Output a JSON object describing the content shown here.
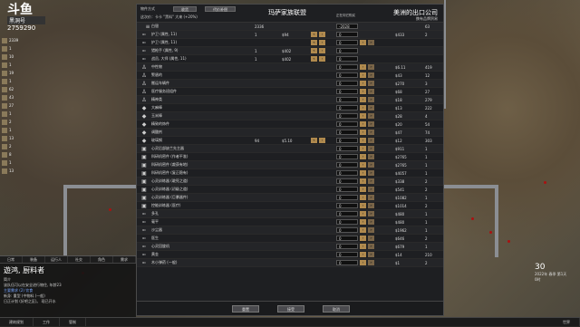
{
  "hud": {
    "logo_main": "斗鱼",
    "logo_sub": "黑洞号",
    "logo_num": "2759290",
    "resources": [
      "2339",
      "1",
      "10",
      "1",
      "19",
      "1",
      "62",
      "43",
      "27",
      "1",
      "2",
      "1",
      "13",
      "2",
      "8",
      "1",
      "13"
    ]
  },
  "dialog": {
    "mode_label": "物件方式",
    "tab_a": "收货",
    "tab_b": "代价补偿",
    "hint": "这次价：卡卡  \"黑料\" 大来 (+20%)",
    "left_title": "玛萨家族联盟",
    "right_title": "美洲的出口公司",
    "right_sub": "携有品牌贸易",
    "mid_sub": "正在向它购买",
    "silver": {
      "name": "白银",
      "left": "2336",
      "qty": "-2028",
      "right": "63"
    },
    "rows": [
      {
        "icon": "gun-icon",
        "name": "护卫 (属性, 11)",
        "lc": "1",
        "lp": "$94",
        "arrows_l": true,
        "qty": "0",
        "arrows_r": false,
        "rp": "$433",
        "rc": "2"
      },
      {
        "icon": "gun-icon",
        "name": "护卫 (属性, 11)",
        "lc": "",
        "lp": "",
        "arrows_l": true,
        "qty": "0",
        "arrows_r": true,
        "rp": "",
        "rc": ""
      },
      {
        "icon": "gun-icon",
        "name": "猎枪手 (属性, 9)",
        "lc": "1",
        "lp": "$402",
        "arrows_l": true,
        "qty": "0",
        "arrows_r": false,
        "rp": "",
        "rc": ""
      },
      {
        "icon": "gun-icon",
        "name": "战员, 大师 (属性, 11)",
        "lc": "1",
        "lp": "$402",
        "arrows_l": true,
        "qty": "0",
        "arrows_r": false,
        "rp": "",
        "rc": ""
      },
      {
        "icon": "person-icon",
        "name": "中性物",
        "lc": "",
        "lp": "",
        "arrows_l": false,
        "qty": "0",
        "arrows_r": true,
        "rp": "$6.11",
        "rc": "419"
      },
      {
        "icon": "person-icon",
        "name": "警盾的",
        "lc": "",
        "lp": "",
        "arrows_l": false,
        "qty": "0",
        "arrows_r": true,
        "rp": "$43",
        "rc": "12"
      },
      {
        "icon": "person-icon",
        "name": "搬运车辆件",
        "lc": "",
        "lp": "",
        "arrows_l": false,
        "qty": "0",
        "arrows_r": true,
        "rp": "$270",
        "rc": "3"
      },
      {
        "icon": "person-icon",
        "name": "医疗服务班组件",
        "lc": "",
        "lp": "",
        "arrows_l": false,
        "qty": "0",
        "arrows_r": true,
        "rp": "$68",
        "rc": "27"
      },
      {
        "icon": "person-icon",
        "name": "精神类",
        "lc": "",
        "lp": "",
        "arrows_l": false,
        "qty": "0",
        "arrows_r": true,
        "rp": "$18",
        "rc": "279"
      },
      {
        "icon": "stone-icon",
        "name": "大麻棒",
        "lc": "",
        "lp": "",
        "arrows_l": false,
        "qty": "0",
        "arrows_r": true,
        "rp": "$13",
        "rc": "222"
      },
      {
        "icon": "stone-icon",
        "name": "玉米棒",
        "lc": "",
        "lp": "",
        "arrows_l": false,
        "qty": "0",
        "arrows_r": true,
        "rp": "$28",
        "rc": "4"
      },
      {
        "icon": "stone-icon",
        "name": "精致的饰件",
        "lc": "",
        "lp": "",
        "arrows_l": false,
        "qty": "0",
        "arrows_r": true,
        "rp": "$20",
        "rc": "54"
      },
      {
        "icon": "stone-icon",
        "name": "调酸剂",
        "lc": "",
        "lp": "",
        "arrows_l": false,
        "qty": "0",
        "arrows_r": true,
        "rp": "$47",
        "rc": "74"
      },
      {
        "icon": "stone-icon",
        "name": "玻璃钢",
        "lc": "94",
        "lp": "$5.10",
        "arrows_l": true,
        "qty": "0",
        "arrows_r": true,
        "rp": "$12",
        "rc": "303"
      },
      {
        "icon": "chip-icon",
        "name": "心灵后部缺兰先主器",
        "lc": "",
        "lp": "",
        "arrows_l": false,
        "qty": "0",
        "arrows_r": true,
        "rp": "$911",
        "rc": "1"
      },
      {
        "icon": "chip-icon",
        "name": "科研机密件 (作者平准)",
        "lc": "",
        "lp": "",
        "arrows_l": false,
        "qty": "0",
        "arrows_r": true,
        "rp": "$2765",
        "rc": "1"
      },
      {
        "icon": "chip-icon",
        "name": "科研机密件 (裁获有地)",
        "lc": "",
        "lp": "",
        "arrows_l": false,
        "qty": "0",
        "arrows_r": true,
        "rp": "$2765",
        "rc": "1"
      },
      {
        "icon": "chip-icon",
        "name": "科研机密件 (复正稳有)",
        "lc": "",
        "lp": "",
        "arrows_l": false,
        "qty": "0",
        "arrows_r": true,
        "rp": "$4057",
        "rc": "1"
      },
      {
        "icon": "chip-icon",
        "name": "心灵训练器 (敢死之道)",
        "lc": "",
        "lp": "",
        "arrows_l": false,
        "qty": "0",
        "arrows_r": true,
        "rp": "$338",
        "rc": "2"
      },
      {
        "icon": "chip-icon",
        "name": "心灵训练器 (初级之道)",
        "lc": "",
        "lp": "",
        "arrows_l": false,
        "qty": "0",
        "arrows_r": true,
        "rp": "$541",
        "rc": "2"
      },
      {
        "icon": "chip-icon",
        "name": "心灵训练器 (巨暴器件)",
        "lc": "",
        "lp": "",
        "arrows_l": false,
        "qty": "0",
        "arrows_r": true,
        "rp": "$1082",
        "rc": "1"
      },
      {
        "icon": "chip-icon",
        "name": "控能训练器 (医疗)",
        "lc": "",
        "lp": "",
        "arrows_l": false,
        "qty": "0",
        "arrows_r": true,
        "rp": "$1014",
        "rc": "2"
      },
      {
        "icon": "gun-icon",
        "name": "多孔",
        "lc": "",
        "lp": "",
        "arrows_l": false,
        "qty": "0",
        "arrows_r": true,
        "rp": "$480",
        "rc": "1"
      },
      {
        "icon": "gun-icon",
        "name": "毫平",
        "lc": "",
        "lp": "",
        "arrows_l": false,
        "qty": "0",
        "arrows_r": true,
        "rp": "$480",
        "rc": "1"
      },
      {
        "icon": "gun-icon",
        "name": "沙尘器",
        "lc": "",
        "lp": "",
        "arrows_l": false,
        "qty": "0",
        "arrows_r": true,
        "rp": "$1962",
        "rc": "1"
      },
      {
        "icon": "gun-icon",
        "name": "医生",
        "lc": "",
        "lp": "",
        "arrows_l": false,
        "qty": "0",
        "arrows_r": true,
        "rp": "$646",
        "rc": "2"
      },
      {
        "icon": "gun-icon",
        "name": "心灵回旋机",
        "lc": "",
        "lp": "",
        "arrows_l": false,
        "qty": "0",
        "arrows_r": true,
        "rp": "$679",
        "rc": "1"
      },
      {
        "icon": "gun-icon",
        "name": "黄金",
        "lc": "",
        "lp": "",
        "arrows_l": false,
        "qty": "0",
        "arrows_r": true,
        "rp": "$14",
        "rc": "210"
      },
      {
        "icon": "gun-icon",
        "name": "木小弹药 (一般)",
        "lc": "",
        "lp": "",
        "arrows_l": false,
        "qty": "0",
        "arrows_r": true,
        "rp": "$1",
        "rc": "2"
      }
    ],
    "btn_reset": "重置",
    "btn_accept": "接受",
    "btn_cancel": "取消"
  },
  "bottom_left": {
    "tabs": [
      "日常",
      "装备",
      "运行人",
      "社交",
      "角色",
      "需求"
    ],
    "title": "遊鸿, 厨料者",
    "lines": [
      "简介",
      "该队伍可以在安全进行物住, 年龄23",
      "主要需求 (2) 饮食",
      "新身: 重型 (中物料 (一般)",
      "日正计划 (好吧之区)。 现已开水"
    ]
  },
  "bottom_bar": [
    "建筑规划",
    "工作",
    "管制",
    "世界"
  ],
  "right_hud": {
    "pop": "30",
    "date": "2022年 春季 第1天",
    "speed": "1",
    "time": "0时"
  }
}
